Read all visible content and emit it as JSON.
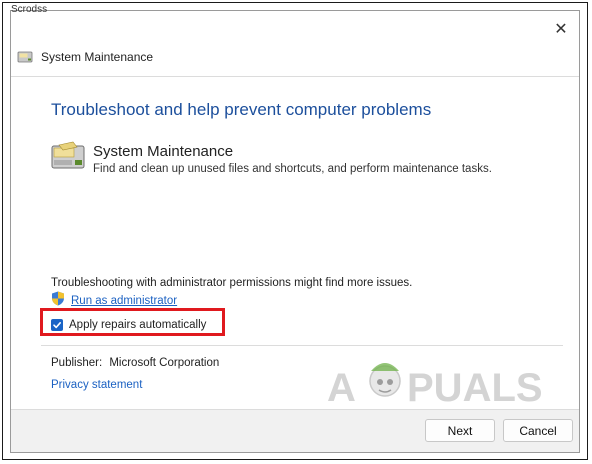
{
  "top_partial_text": "Scrodss",
  "window": {
    "title": "System Maintenance",
    "close_glyph": "✕"
  },
  "content": {
    "heading": "Troubleshoot and help prevent computer problems",
    "task_title": "System Maintenance",
    "task_description": "Find and clean up unused files and shortcuts, and perform maintenance tasks.",
    "admin_info": "Troubleshooting with administrator permissions might find more issues.",
    "run_as_admin": "Run as administrator",
    "apply_repairs_label": "Apply repairs automatically",
    "apply_repairs_checked": true,
    "publisher_label": "Publisher:",
    "publisher_value": "Microsoft Corporation",
    "privacy_link": "Privacy statement"
  },
  "watermark": {
    "text_left": "A",
    "text_right": "PUALS"
  },
  "buttons": {
    "next": "Next",
    "cancel": "Cancel"
  },
  "colors": {
    "heading": "#1c4f9c",
    "link": "#1b61c2",
    "highlight_box": "#e0191e",
    "checkbox": "#1a64c6"
  },
  "icons": {
    "window_icon": "system-maintenance-icon",
    "task_icon": "system-maintenance-icon",
    "admin_icon": "uac-shield-icon",
    "close_icon": "close-icon",
    "checkbox_icon": "check-icon"
  }
}
